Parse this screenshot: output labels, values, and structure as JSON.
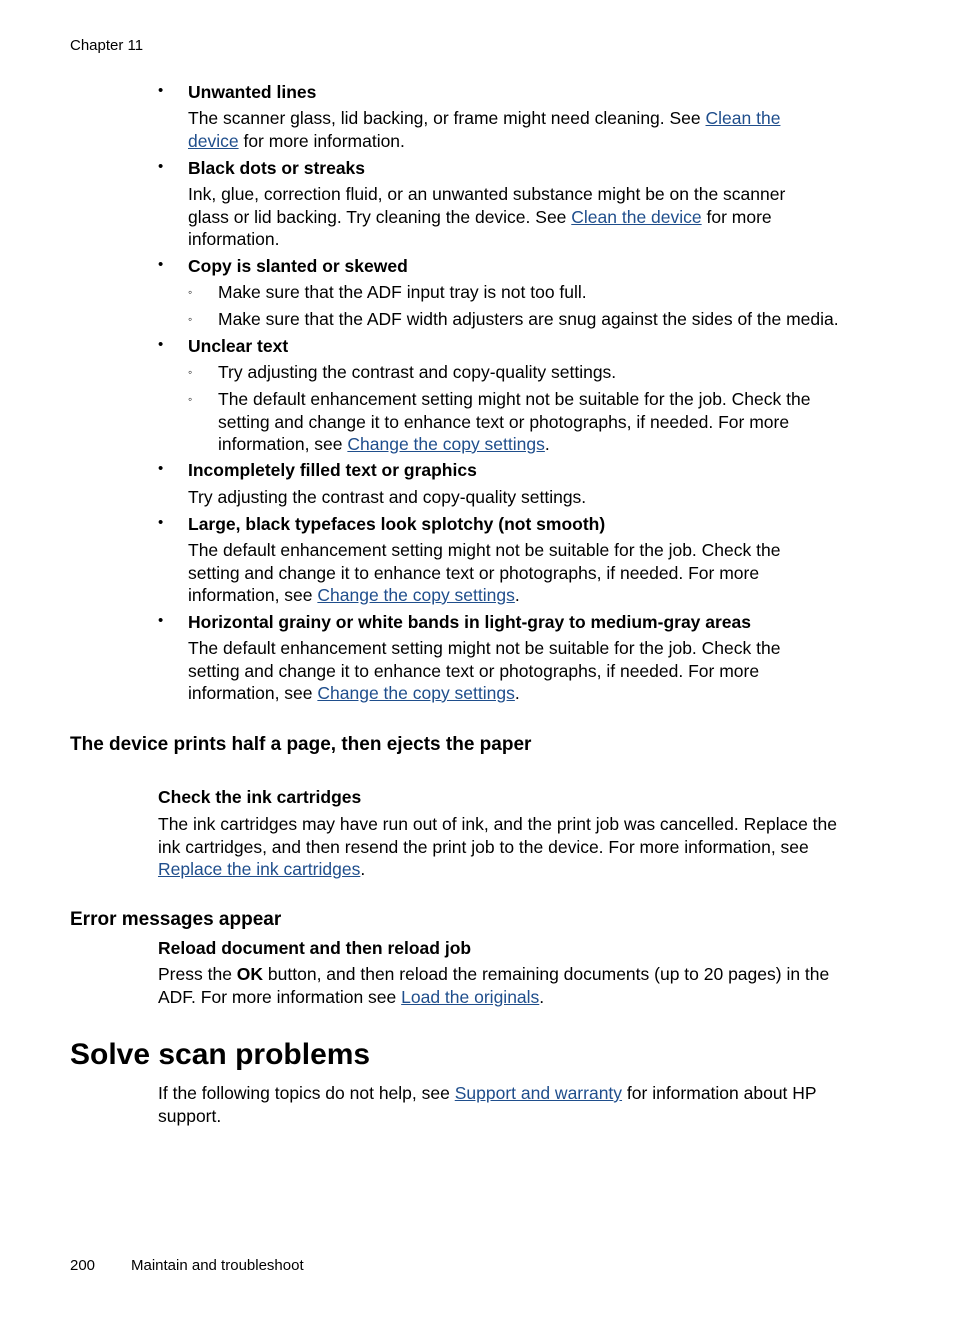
{
  "header": {
    "running_head": "Chapter 11"
  },
  "items": [
    {
      "title": "Unwanted lines",
      "text_before": "The scanner glass, lid backing, or frame might need cleaning. See ",
      "link": "Clean the device",
      "text_after": " for more information."
    },
    {
      "title": "Black dots or streaks",
      "text_before": "Ink, glue, correction fluid, or an unwanted substance might be on the scanner glass or lid backing. Try cleaning the device. See ",
      "link": "Clean the device",
      "text_after": " for more information."
    },
    {
      "title": "Copy is slanted or skewed",
      "subs": [
        "Make sure that the ADF input tray is not too full.",
        "Make sure that the ADF width adjusters are snug against the sides of the media."
      ]
    },
    {
      "title": "Unclear text",
      "sub1": "Try adjusting the contrast and copy-quality settings.",
      "sub2_before": "The default enhancement setting might not be suitable for the job. Check the setting and change it to enhance text or photographs, if needed. For more information, see ",
      "sub2_link": "Change the copy settings",
      "sub2_after": "."
    },
    {
      "title": "Incompletely filled text or graphics",
      "text": "Try adjusting the contrast and copy-quality settings."
    },
    {
      "title": "Large, black typefaces look splotchy (not smooth)",
      "text_before": "The default enhancement setting might not be suitable for the job. Check the setting and change it to enhance text or photographs, if needed. For more information, see ",
      "link": "Change the copy settings",
      "text_after": "."
    },
    {
      "title": "Horizontal grainy or white bands in light-gray to medium-gray areas",
      "text_before": "The default enhancement setting might not be suitable for the job. Check the setting and change it to enhance text or photographs, if needed. For more information, see ",
      "link": "Change the copy settings",
      "text_after": "."
    }
  ],
  "half_page": {
    "heading": "The device prints half a page, then ejects the paper",
    "subheading": "Check the ink cartridges",
    "text_before": "The ink cartridges may have run out of ink, and the print job was cancelled. Replace the ink cartridges, and then resend the print job to the device. For more information, see ",
    "link": "Replace the ink cartridges",
    "text_after": "."
  },
  "errors": {
    "heading": "Error messages appear",
    "subheading": "Reload document and then reload job",
    "text_1": "Press the ",
    "bold": "OK",
    "text_2": " button, and then reload the remaining documents (up to 20 pages) in the ADF. For more information see ",
    "link": "Load the originals",
    "text_after": "."
  },
  "scan": {
    "heading": "Solve scan problems",
    "text_before": "If the following topics do not help, see ",
    "link": "Support and warranty",
    "text_after": " for information about HP support."
  },
  "footer": {
    "page_number": "200",
    "section": "Maintain and troubleshoot"
  },
  "symbols": {
    "bullet": "•",
    "circle": "◦"
  }
}
